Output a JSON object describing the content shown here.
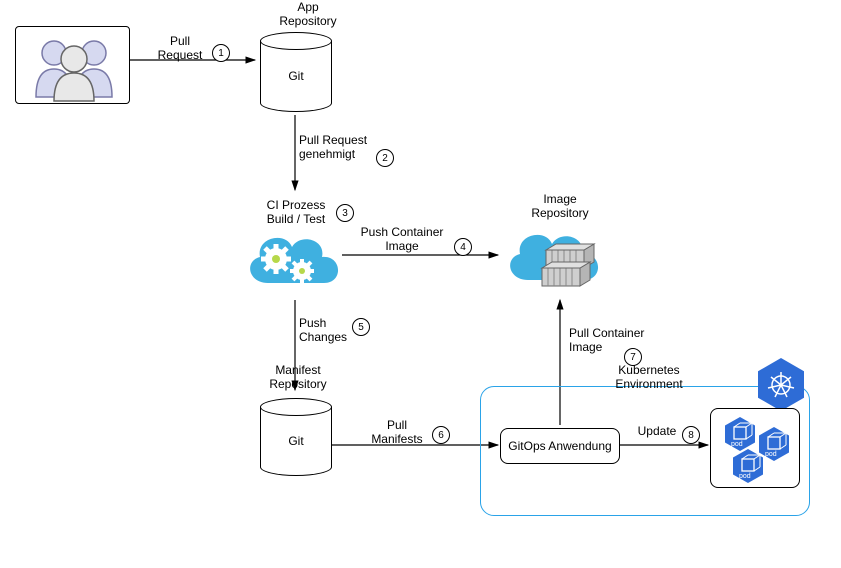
{
  "nodes": {
    "app_repo_title": "App\nRepository",
    "app_repo_label": "Git",
    "ci_process": "CI Prozess\nBuild / Test",
    "image_repo_title": "Image\nRepository",
    "manifest_repo_title": "Manifest\nRepository",
    "manifest_repo_label": "Git",
    "gitops_app": "GitOps Anwendung",
    "k8s_env": "Kubernetes\nEnvironment",
    "pod_label": "pod"
  },
  "edges": {
    "1": {
      "label": "Pull\nRequest",
      "step": "1"
    },
    "2": {
      "label": "Pull Request\ngenehmigt",
      "step": "2"
    },
    "3": {
      "label": "",
      "step": "3"
    },
    "4": {
      "label": "Push Container\nImage",
      "step": "4"
    },
    "5": {
      "label": "Push\nChanges",
      "step": "5"
    },
    "6": {
      "label": "Pull\nManifests",
      "step": "6"
    },
    "7": {
      "label": "Pull Container\nImage",
      "step": "7"
    },
    "8": {
      "label": "Update",
      "step": "8"
    }
  }
}
